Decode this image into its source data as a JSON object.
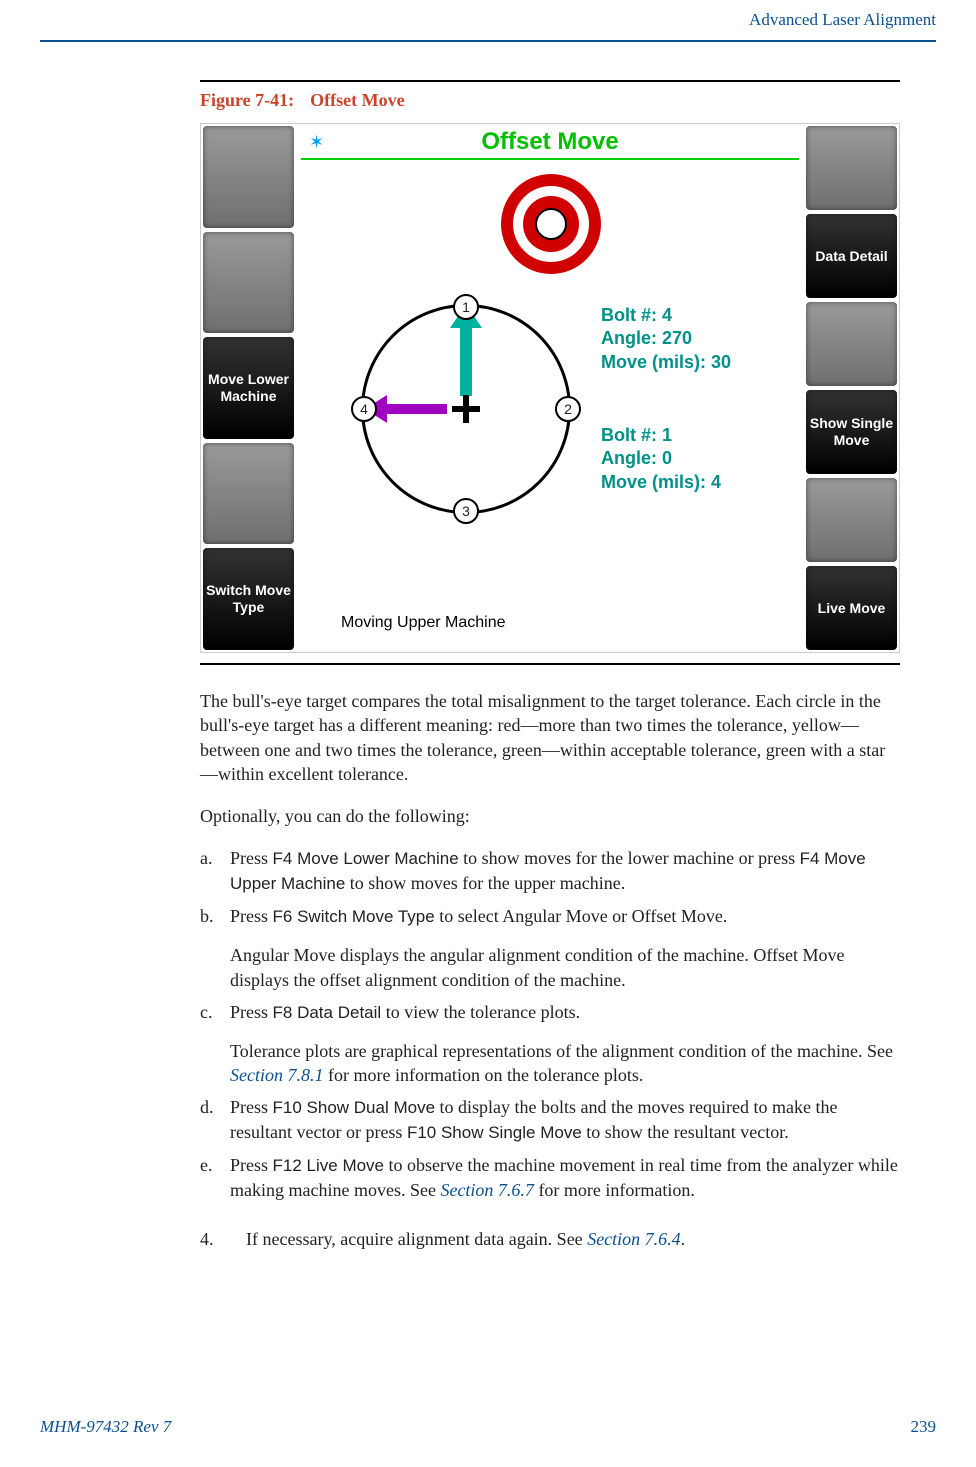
{
  "header": {
    "section_title": "Advanced Laser Alignment"
  },
  "figure": {
    "number": "Figure 7-41:",
    "title": "Offset Move"
  },
  "screenshot": {
    "title": "Offset Move",
    "left_buttons": [
      "",
      "",
      "Move Lower Machine",
      "",
      "Switch Move Type"
    ],
    "right_buttons": [
      "",
      "Data Detail",
      "",
      "Show Single Move",
      "",
      "Live Move"
    ],
    "nodes": [
      "1",
      "2",
      "3",
      "4"
    ],
    "readout1": {
      "l1": "Bolt #: 4",
      "l2": "Angle: 270",
      "l3": "Move (mils): 30"
    },
    "readout2": {
      "l1": "Bolt #: 1",
      "l2": "Angle: 0",
      "l3": "Move (mils): 4"
    },
    "status": "Moving Upper Machine"
  },
  "para1": "The bull's-eye target compares the total misalignment to the target tolerance. Each circle in the bull's-eye target has a different meaning: red—more than two times the tolerance, yellow—between one and two times the tolerance, green—within acceptable tolerance, green with a star—within excellent tolerance.",
  "para2": "Optionally, you can do the following:",
  "sub": {
    "a": {
      "label": "a.",
      "t1": "Press ",
      "k1": "F4 Move Lower Machine",
      "t2": " to show moves for the lower machine or press ",
      "k2": "F4 Move Upper Machine",
      "t3": " to show moves for the upper machine."
    },
    "b": {
      "label": "b.",
      "t1": "Press ",
      "k1": "F6 Switch Move Type",
      "t2": " to select Angular Move or Offset Move.",
      "p2": "Angular Move displays the angular alignment condition of the machine. Offset Move displays the offset alignment condition of the machine."
    },
    "c": {
      "label": "c.",
      "t1": "Press ",
      "k1": "F8 Data Detail",
      "t2": " to view the tolerance plots.",
      "p2a": "Tolerance plots are graphical representations of the alignment condition of the machine. See ",
      "link": "Section 7.8.1",
      "p2b": " for more information on the tolerance plots."
    },
    "d": {
      "label": "d.",
      "t1": "Press ",
      "k1": "F10 Show Dual Move",
      "t2": " to display the bolts and the moves required to make the resultant vector or press ",
      "k2": "F10 Show Single Move",
      "t3": " to show the resultant vector."
    },
    "e": {
      "label": "e.",
      "t1": "Press ",
      "k1": "F12 Live Move",
      "t2": " to observe the machine movement in real time from the analyzer while making machine moves. See ",
      "link": "Section 7.6.7",
      "t3": " for more information."
    }
  },
  "step4": {
    "num": "4.",
    "t1": "If necessary, acquire alignment data again. See ",
    "link": "Section 7.6.4",
    "t2": "."
  },
  "footer": {
    "left": "MHM-97432 Rev 7",
    "right": "239"
  }
}
